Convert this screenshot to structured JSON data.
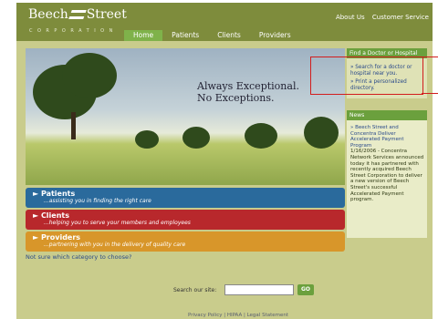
{
  "header": {
    "logo_text_1": "Beech",
    "logo_text_2": "Street",
    "logo_sub": "CORPORATION",
    "top_links": [
      "About Us",
      "Customer Service"
    ],
    "nav": [
      "Home",
      "Patients",
      "Clients",
      "Providers"
    ]
  },
  "hero": {
    "line1": "Always Exceptional.",
    "line2": "No Exceptions."
  },
  "bands": [
    {
      "title": "Patients",
      "subtitle": "...assisting you in finding the right care"
    },
    {
      "title": "Clients",
      "subtitle": "...helping you to serve your members and employees"
    },
    {
      "title": "Providers",
      "subtitle": "...partnering with you in the delivery of quality care"
    }
  ],
  "unsure_link": "Not sure which category to choose?",
  "sidebar": {
    "find_title": "Find a Doctor or Hospital",
    "find_links": [
      "Search for a doctor or hospital near you.",
      "Print a personalized directory."
    ],
    "news_title": "News",
    "news_link": "Beech Street and Concentra Deliver Accelerated Payment Program",
    "news_text": "1/16/2006 - Concentra Network Services announced today it has partnered with recently acquired Beech Street Corporation to deliver a new version of Beech Street's successful Accelerated Payment program."
  },
  "search": {
    "label": "Search our site:",
    "value": "",
    "button": "GO"
  },
  "footer": "Privacy Policy | HIPAA | Legal Statement",
  "colors": {
    "header": "#7e8c3c",
    "nav_active": "#7fb24a",
    "patients": "#2a6a9c",
    "clients": "#b8282c",
    "providers": "#d8962a",
    "callout": "#d21d1d"
  }
}
